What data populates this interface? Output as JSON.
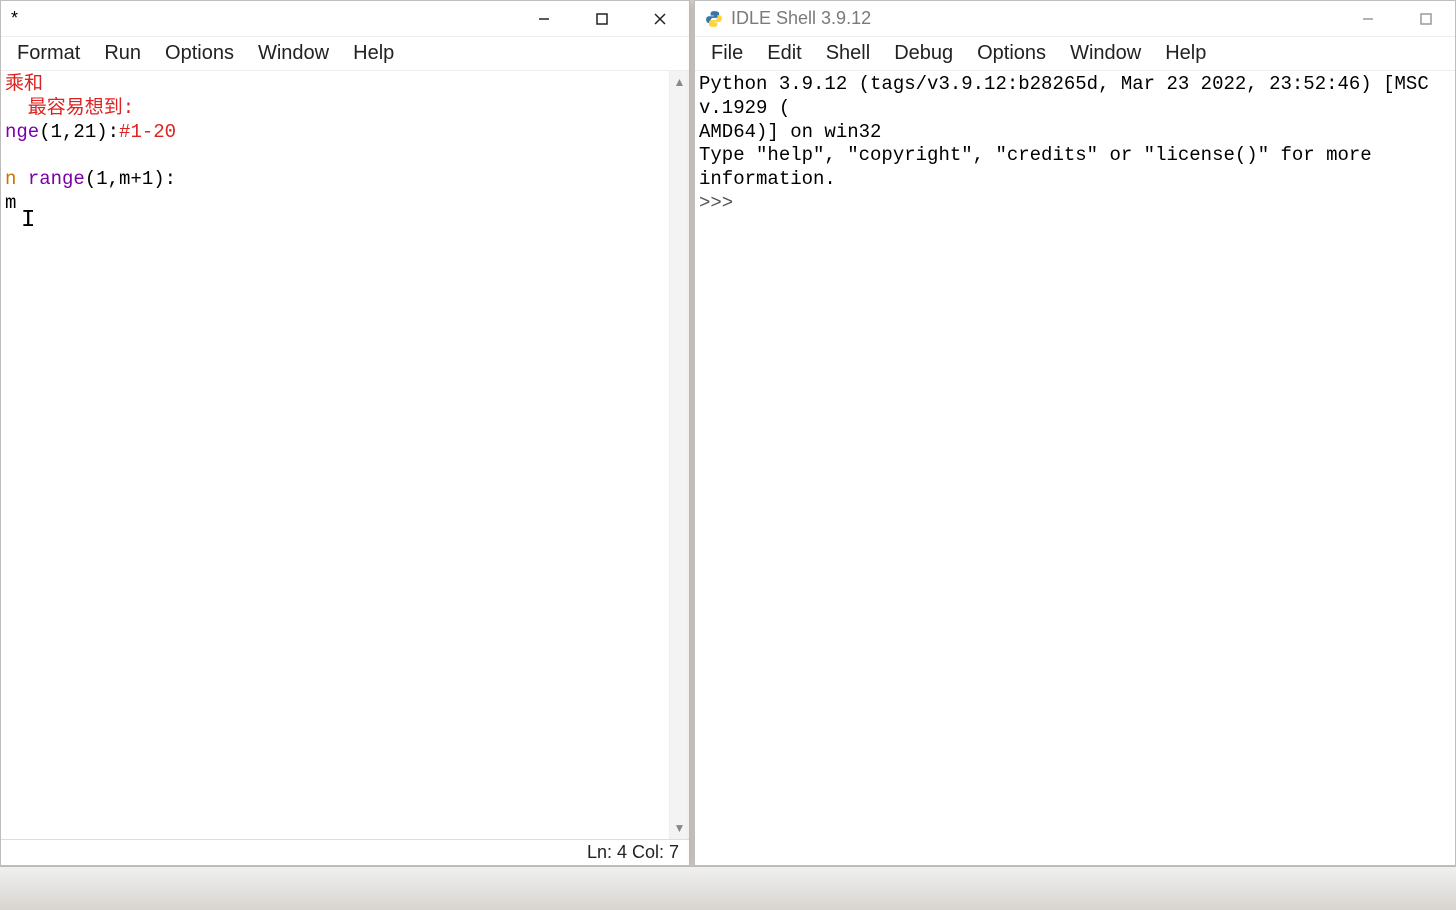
{
  "editor": {
    "title": "*",
    "menus": [
      "Format",
      "Run",
      "Options",
      "Window",
      "Help"
    ],
    "code": {
      "line1_comment": "乘和",
      "line2_comment": "  最容易想到:",
      "line3_builtin": "nge",
      "line3_args": "(1,21):",
      "line3_trail_comment": "#1-20",
      "line4_kw": "n ",
      "line4_builtin": "range",
      "line4_args": "(1,m+1):",
      "line5": "m"
    },
    "status": "Ln: 4  Col: 7"
  },
  "shell": {
    "title": "IDLE Shell 3.9.12",
    "menus": [
      "File",
      "Edit",
      "Shell",
      "Debug",
      "Options",
      "Window",
      "Help"
    ],
    "banner1": "Python 3.9.12 (tags/v3.9.12:b28265d, Mar 23 2022, 23:52:46) [MSC v.1929 (",
    "banner2": "AMD64)] on win32",
    "banner3": "Type \"help\", \"copyright\", \"credits\" or \"license()\" for more information.",
    "prompt": ">>> "
  }
}
